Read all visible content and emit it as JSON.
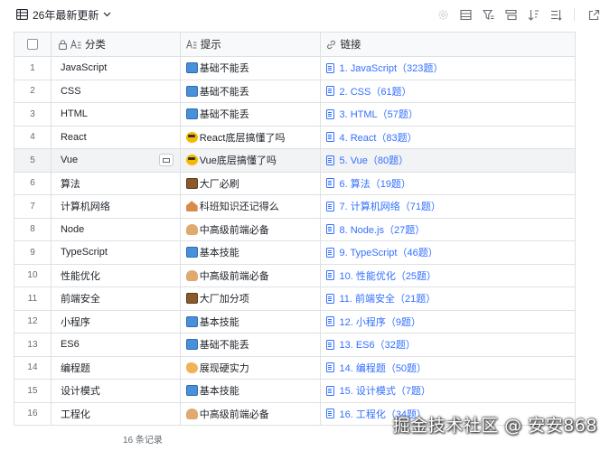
{
  "view": {
    "title": "26年最新更新"
  },
  "columns": {
    "category": "分类",
    "tip": "提示",
    "link": "链接"
  },
  "rows": [
    {
      "idx": "1",
      "category": "JavaScript",
      "tip_icon": "book-emoji",
      "tip": "基础不能丢",
      "link": "1. JavaScript（323题）"
    },
    {
      "idx": "2",
      "category": "CSS",
      "tip_icon": "book-emoji",
      "tip": "基础不能丢",
      "link": "2. CSS（61题）"
    },
    {
      "idx": "3",
      "category": "HTML",
      "tip_icon": "book-emoji",
      "tip": "基础不能丢",
      "link": "3. HTML（57题）"
    },
    {
      "idx": "4",
      "category": "React",
      "tip_icon": "face-emoji",
      "tip": "React底层搞懂了吗",
      "link": "4. React（83题）"
    },
    {
      "idx": "5",
      "category": "Vue",
      "tip_icon": "face-emoji",
      "tip": "Vue底层搞懂了吗",
      "link": "5. Vue（80题）"
    },
    {
      "idx": "6",
      "category": "算法",
      "tip_icon": "box-emoji",
      "tip": "大厂必刷",
      "link": "6. 算法（19题）"
    },
    {
      "idx": "7",
      "category": "计算机网络",
      "tip_icon": "house-emoji",
      "tip": "科班知识还记得么",
      "link": "7. 计算机网络（71题）"
    },
    {
      "idx": "8",
      "category": "Node",
      "tip_icon": "person-emoji",
      "tip": "中高级前端必备",
      "link": "8. Node.js（27题）"
    },
    {
      "idx": "9",
      "category": "TypeScript",
      "tip_icon": "book-emoji",
      "tip": "基本技能",
      "link": "9. TypeScript（46题）"
    },
    {
      "idx": "10",
      "category": "性能优化",
      "tip_icon": "person-emoji",
      "tip": "中高级前端必备",
      "link": "10. 性能优化（25题）"
    },
    {
      "idx": "11",
      "category": "前端安全",
      "tip_icon": "box-emoji",
      "tip": "大厂加分项",
      "link": "11. 前端安全（21题）"
    },
    {
      "idx": "12",
      "category": "小程序",
      "tip_icon": "book-emoji",
      "tip": "基本技能",
      "link": "12. 小程序（9题）"
    },
    {
      "idx": "13",
      "category": "ES6",
      "tip_icon": "book-emoji",
      "tip": "基础不能丢",
      "link": "13. ES6（32题）"
    },
    {
      "idx": "14",
      "category": "编程题",
      "tip_icon": "arm-emoji",
      "tip": "展现硬实力",
      "link": "14. 编程题（50题）"
    },
    {
      "idx": "15",
      "category": "设计模式",
      "tip_icon": "book-emoji",
      "tip": "基本技能",
      "link": "15. 设计模式（7题）"
    },
    {
      "idx": "16",
      "category": "工程化",
      "tip_icon": "person-emoji",
      "tip": "中高级前端必备",
      "link": "16. 工程化（34题）"
    }
  ],
  "selected_row": "5",
  "footer": {
    "count": "16 条记录"
  },
  "watermark": "掘金技术社区 @ 安安868",
  "colors": {
    "link": "#3370ff",
    "border": "#dee0e3",
    "header_bg": "#f8f9fa",
    "selected_bg": "#f2f3f5"
  }
}
